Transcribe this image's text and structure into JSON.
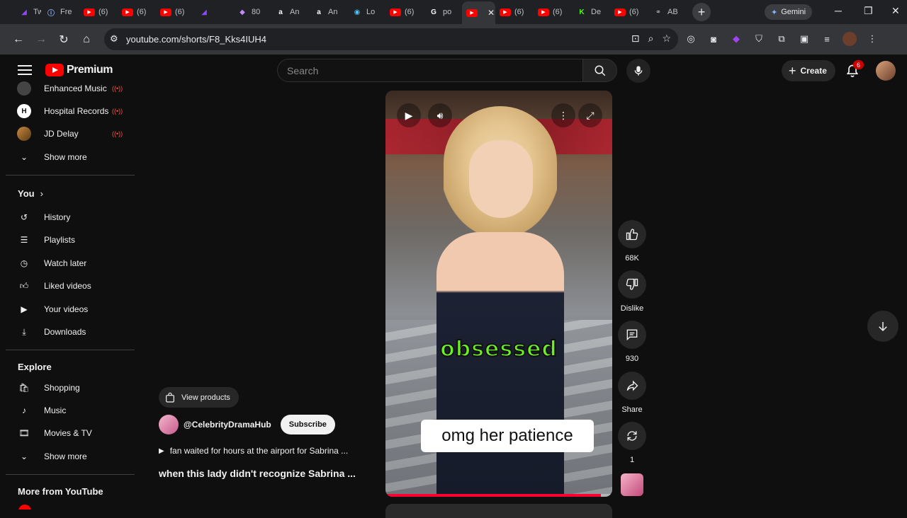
{
  "browser": {
    "tabs": [
      {
        "label": "Tw",
        "icon": "twitch-icon",
        "color": "#9146ff"
      },
      {
        "label": "Fre",
        "icon": "info-icon",
        "color": "#8ab4f8"
      },
      {
        "label": "(6)",
        "icon": "youtube-icon",
        "color": "#ff0000"
      },
      {
        "label": "(6)",
        "icon": "youtube-icon",
        "color": "#ff0000"
      },
      {
        "label": "(6)",
        "icon": "youtube-icon",
        "color": "#ff0000"
      },
      {
        "label": "",
        "icon": "twitch-icon",
        "color": "#9146ff"
      },
      {
        "label": "80",
        "icon": "app-icon",
        "color": "#c58af9"
      },
      {
        "label": "An",
        "icon": "amazon-icon",
        "color": "#ffffff"
      },
      {
        "label": "An",
        "icon": "amazon-icon",
        "color": "#ffffff"
      },
      {
        "label": "Lo",
        "icon": "globe-icon",
        "color": "#4fc3f7"
      },
      {
        "label": "(6)",
        "icon": "youtube-icon",
        "color": "#ff0000"
      },
      {
        "label": "po",
        "icon": "google-icon",
        "color": "#ffffff"
      },
      {
        "label": "",
        "icon": "youtube-icon",
        "color": "#ff0000",
        "active": true
      },
      {
        "label": "(6)",
        "icon": "youtube-icon",
        "color": "#ff0000"
      },
      {
        "label": "(6)",
        "icon": "youtube-icon",
        "color": "#ff0000"
      },
      {
        "label": "De",
        "icon": "kick-icon",
        "color": "#53fc18"
      },
      {
        "label": "(6)",
        "icon": "youtube-icon",
        "color": "#ff0000"
      },
      {
        "label": "AB",
        "icon": "ab-icon",
        "color": "#9aa0a6"
      }
    ],
    "gemini_label": "Gemini",
    "url": "youtube.com/shorts/F8_Kks4IUH4"
  },
  "youtube": {
    "logo_text": "Premium",
    "search_placeholder": "Search",
    "create_label": "Create",
    "notification_count": "6"
  },
  "sidebar": {
    "subscriptions": [
      {
        "label": "Enhanced Music",
        "live": true
      },
      {
        "label": "Hospital Records",
        "live": true,
        "avatar": "H"
      },
      {
        "label": "JD Delay",
        "live": true
      }
    ],
    "show_more_1": "Show more",
    "you_title": "You",
    "you_items": [
      "History",
      "Playlists",
      "Watch later",
      "Liked videos",
      "Your videos",
      "Downloads"
    ],
    "explore_title": "Explore",
    "explore_items": [
      "Shopping",
      "Music",
      "Movies & TV"
    ],
    "show_more_2": "Show more",
    "more_title": "More from YouTube"
  },
  "short": {
    "caption_green": "obsessed",
    "caption_white": "omg her patience",
    "progress_percent": 95,
    "view_products": "View products",
    "channel": "@CelebrityDramaHub",
    "subscribe": "Subscribe",
    "sound": "fan waited for hours at the airport for Sabrina ...",
    "title": "when this lady didn't recognize Sabrina ..."
  },
  "actions": {
    "likes": "68K",
    "dislike": "Dislike",
    "comments": "930",
    "share": "Share",
    "remix": "1"
  }
}
